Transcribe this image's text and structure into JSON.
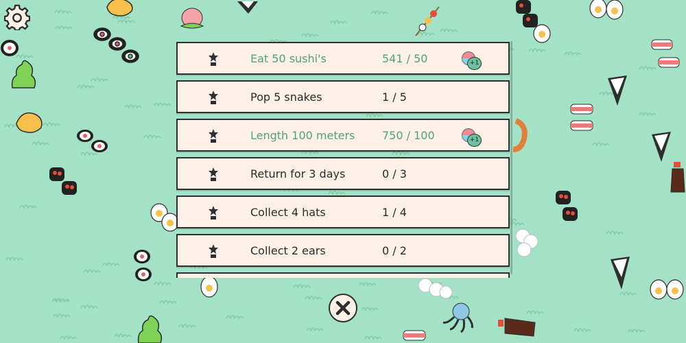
{
  "achievements": [
    {
      "label": "Eat 50 sushi's",
      "progress": "541 / 50",
      "completed": true,
      "reward": "+1"
    },
    {
      "label": "Pop 5 snakes",
      "progress": "1 / 5",
      "completed": false,
      "reward": ""
    },
    {
      "label": "Length 100 meters",
      "progress": "750 / 100",
      "completed": true,
      "reward": "+1"
    },
    {
      "label": "Return for 3 days",
      "progress": "0 / 3",
      "completed": false,
      "reward": ""
    },
    {
      "label": "Collect 4 hats",
      "progress": "1 / 4",
      "completed": false,
      "reward": ""
    },
    {
      "label": "Collect 2 ears",
      "progress": "0 / 2",
      "completed": false,
      "reward": ""
    }
  ],
  "icons": {
    "settings": "gear-icon",
    "trophy": "trophy-icon",
    "reward": "capsule-icon",
    "close": "close-icon"
  },
  "colors": {
    "background": "#a3e2c6",
    "row": "#fdf0e6",
    "completed_text": "#4fa37a",
    "text": "#2b2b2b"
  }
}
